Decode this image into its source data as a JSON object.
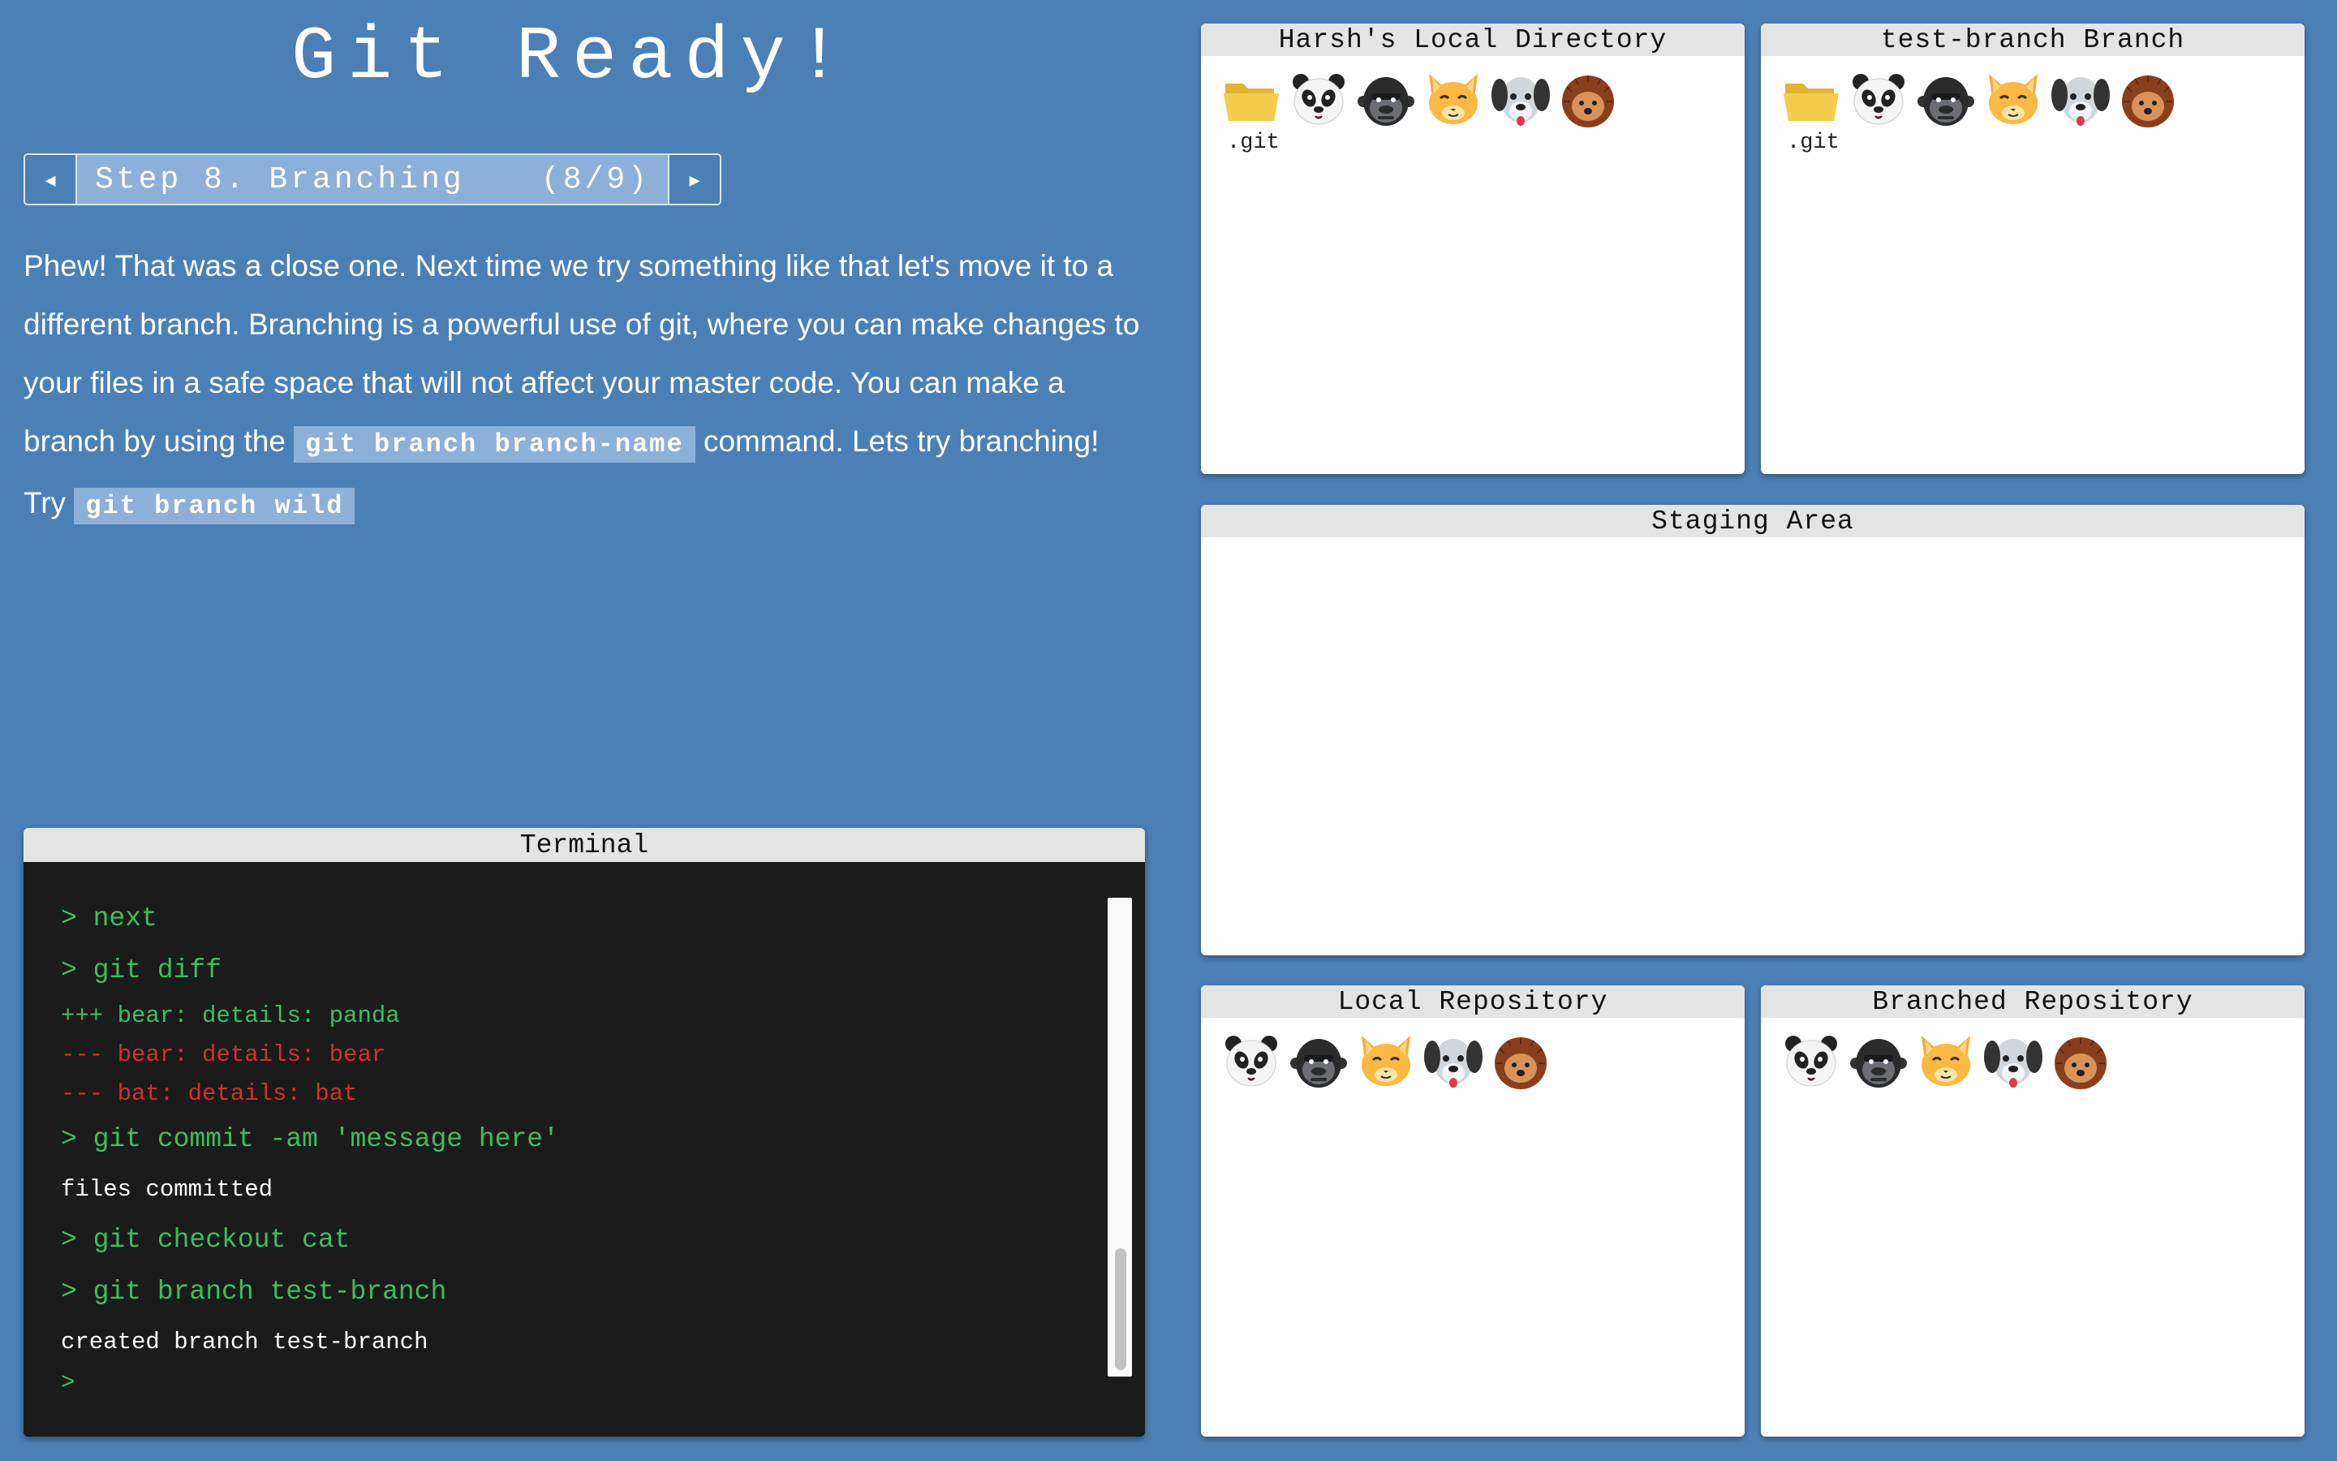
{
  "app": {
    "title": "Git Ready!"
  },
  "step_nav": {
    "prev_label": "◂",
    "next_label": "▸",
    "step_label": "Step 8. Branching",
    "progress": "(8/9)"
  },
  "instructions": {
    "p1_text_before": "Phew! That was a close one. Next time we try something like that let's move it to a different branch. Branching is a powerful use of git, where you can make changes to your files in a safe space that will not affect your master code. You can make a branch by using the ",
    "p1_code": "git branch branch-name",
    "p1_text_after": " command. Lets try branching!",
    "p2_text_before": "Try ",
    "p2_code": "git branch wild"
  },
  "panels": {
    "local_directory": {
      "title": "Harsh's Local Directory",
      "folder_label": ".git",
      "icons": [
        "folder-icon",
        "panda-icon",
        "gorilla-icon",
        "cat-icon",
        "dog-icon",
        "hedgehog-icon"
      ]
    },
    "test_branch": {
      "title": "test-branch Branch",
      "folder_label": ".git",
      "icons": [
        "folder-icon",
        "panda-icon",
        "gorilla-icon",
        "cat-icon",
        "dog-icon",
        "hedgehog-icon"
      ]
    },
    "staging_area": {
      "title": "Staging Area"
    },
    "local_repository": {
      "title": "Local Repository",
      "icons": [
        "panda-icon",
        "gorilla-icon",
        "cat-icon",
        "dog-icon",
        "hedgehog-icon"
      ]
    },
    "branched_repository": {
      "title": "Branched Repository",
      "icons": [
        "panda-icon",
        "gorilla-icon",
        "cat-icon",
        "dog-icon",
        "hedgehog-icon"
      ]
    }
  },
  "terminal": {
    "title": "Terminal",
    "lines": [
      {
        "kind": "cmd",
        "text": "> next"
      },
      {
        "kind": "cmd",
        "text": "> git diff"
      },
      {
        "kind": "add",
        "text": "+++ bear: details: panda"
      },
      {
        "kind": "del",
        "text": "--- bear: details: bear"
      },
      {
        "kind": "del",
        "text": "--- bat: details: bat"
      },
      {
        "kind": "cmd",
        "text": "> git commit -am 'message here'"
      },
      {
        "kind": "out",
        "text": "files committed"
      },
      {
        "kind": "cmd",
        "text": "> git checkout cat"
      },
      {
        "kind": "cmd",
        "text": "> git branch test-branch"
      },
      {
        "kind": "out",
        "text": "created branch test-branch"
      },
      {
        "kind": "prompt",
        "text": ">"
      }
    ]
  },
  "colors": {
    "background": "#4b80b7",
    "terminal_bg": "#1b1b1b",
    "cmd_green": "#3bbf5f",
    "diff_red": "#d0312d"
  }
}
